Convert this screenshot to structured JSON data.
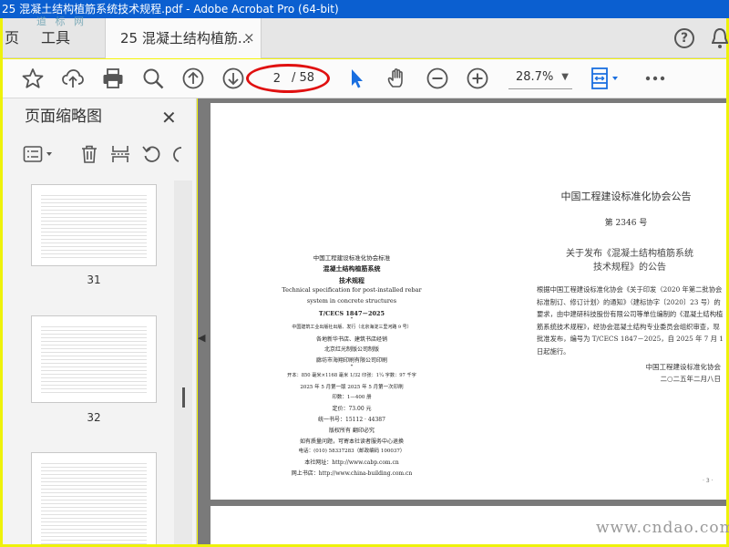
{
  "window": {
    "title": "25 混凝土结构植筋系统技术规程.pdf - Adobe Acrobat Pro (64-bit)"
  },
  "tabs": {
    "home": "页",
    "tools": "工具",
    "document": "25 混凝土结构植筋...",
    "close": "×"
  },
  "toolbar": {
    "page_current": "2",
    "page_total": "/ 58",
    "zoom": "28.7%",
    "zoom_caret": "▼"
  },
  "sidebar": {
    "title": "页面缩略图",
    "close": "✕",
    "thumbnails": [
      {
        "page": "31"
      },
      {
        "page": "32"
      },
      {
        "page": ""
      }
    ],
    "logo": "道 标 网"
  },
  "document": {
    "left_page": {
      "org": "中国工程建设标准化协会标准",
      "title": "混凝土结构植筋系统",
      "subtitle": "技术规程",
      "en1": "Technical specification for post-installed rebar",
      "en2": "system in concrete structures",
      "code": "T/CECS 1847－2025",
      "star1": "*",
      "publisher": "中国建筑工业出版社出版、发行（北京海淀三里河路 9 号）",
      "dist": "各地新华书店、建筑书店经销",
      "typeset": "北京红光制版公司制版",
      "printer": "廊坊市海翔印刷有限公司印刷",
      "star2": "*",
      "spec": "开本：850 毫米×1168 毫米  1/32  印张：1¼  字数：97 千字",
      "edition": "2025 年 5 月第一版    2025 年 5 月第一次印刷",
      "print_run": "印数：1—400 册",
      "price": "定价：73.00 元",
      "isbn": "统一书号：15112 · 44387",
      "rights": "版权所有   翻印必究",
      "quality": "如有质量问题，可寄本社读者服务中心退换",
      "phone": "电话：(010) 58337283（邮政编码 100037）",
      "site": "本社网址：http://www.cabp.com.cn",
      "store": "网上书店：http://www.china-building.com.cn"
    },
    "right_page": {
      "header": "中国工程建设标准化协会公告",
      "number": "第 2346 号",
      "subject1": "关于发布《混凝土结构植筋系统",
      "subject2": "技术规程》的公告",
      "body": "根据中国工程建设标准化协会《关于印发〈2020 年第二批协会标准制订、修订计划〉的通知》（建标协字〔2020〕23 号）的要求，由中建研科技股份有限公司等单位编制的《混凝土结构植筋系统技术规程》，经协会混凝土结构专业委员会组织审查，现批准发布，编号为 T/CECS 1847－2025，自 2025 年 7 月 1 日起施行。",
      "signer": "中国工程建设标准化协会",
      "date": "二○二五年二月八日",
      "page_no": "· 3 ·"
    }
  },
  "watermark": "www.cndao.com",
  "colors": {
    "titlebar": "#0b5fd0",
    "accent_select": "#1a6fe0",
    "highlight": "#e01010",
    "frame": "#f5f50a"
  }
}
